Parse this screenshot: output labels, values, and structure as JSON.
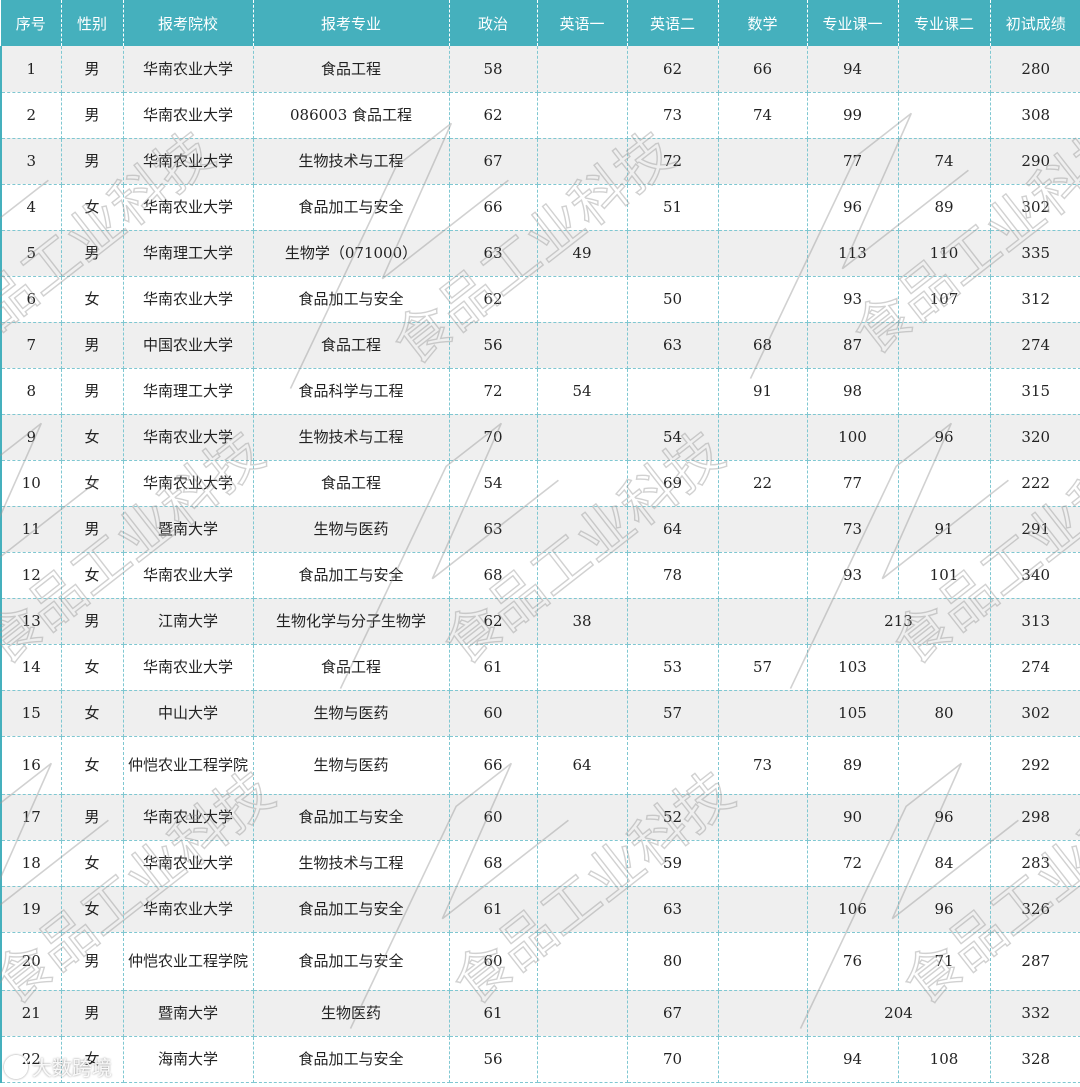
{
  "table": {
    "headers": [
      "序号",
      "性别",
      "报考院校",
      "报考专业",
      "政治",
      "英语一",
      "英语二",
      "数学",
      "专业课一",
      "专业课二",
      "初试成绩"
    ],
    "rows": [
      {
        "cells": [
          "1",
          "男",
          "华南农业大学",
          "食品工程",
          "58",
          "",
          "62",
          "66",
          "94",
          "",
          "280"
        ]
      },
      {
        "cells": [
          "2",
          "男",
          "华南农业大学",
          "086003 食品工程",
          "62",
          "",
          "73",
          "74",
          "99",
          "",
          "308"
        ]
      },
      {
        "cells": [
          "3",
          "男",
          "华南农业大学",
          "生物技术与工程",
          "67",
          "",
          "72",
          "",
          "77",
          "74",
          "290"
        ]
      },
      {
        "cells": [
          "4",
          "女",
          "华南农业大学",
          "食品加工与安全",
          "66",
          "",
          "51",
          "",
          "96",
          "89",
          "302"
        ]
      },
      {
        "cells": [
          "5",
          "男",
          "华南理工大学",
          "生物学（071000）",
          "63",
          "49",
          "",
          "",
          "113",
          "110",
          "335"
        ]
      },
      {
        "cells": [
          "6",
          "女",
          "华南农业大学",
          "食品加工与安全",
          "62",
          "",
          "50",
          "",
          "93",
          "107",
          "312"
        ]
      },
      {
        "cells": [
          "7",
          "男",
          "中国农业大学",
          "食品工程",
          "56",
          "",
          "63",
          "68",
          "87",
          "",
          "274"
        ]
      },
      {
        "cells": [
          "8",
          "男",
          "华南理工大学",
          "食品科学与工程",
          "72",
          "54",
          "",
          "91",
          "98",
          "",
          "315"
        ]
      },
      {
        "cells": [
          "9",
          "女",
          "华南农业大学",
          "生物技术与工程",
          "70",
          "",
          "54",
          "",
          "100",
          "96",
          "320"
        ]
      },
      {
        "cells": [
          "10",
          "女",
          "华南农业大学",
          "食品工程",
          "54",
          "",
          "69",
          "22",
          "77",
          "",
          "222"
        ]
      },
      {
        "cells": [
          "11",
          "男",
          "暨南大学",
          "生物与医药",
          "63",
          "",
          "64",
          "",
          "73",
          "91",
          "291"
        ]
      },
      {
        "cells": [
          "12",
          "女",
          "华南农业大学",
          "食品加工与安全",
          "68",
          "",
          "78",
          "",
          "93",
          "101",
          "340"
        ]
      },
      {
        "cells": [
          "13",
          "男",
          "江南大学",
          "生物化学与分子生物学",
          "62",
          "38",
          "",
          "",
          "213",
          "313"
        ],
        "merged": true
      },
      {
        "cells": [
          "14",
          "女",
          "华南农业大学",
          "食品工程",
          "61",
          "",
          "53",
          "57",
          "103",
          "",
          "274"
        ]
      },
      {
        "cells": [
          "15",
          "女",
          "中山大学",
          "生物与医药",
          "60",
          "",
          "57",
          "",
          "105",
          "80",
          "302"
        ]
      },
      {
        "cells": [
          "16",
          "女",
          "仲恺农业工程学院",
          "生物与医药",
          "66",
          "64",
          "",
          "73",
          "89",
          "",
          "292"
        ]
      },
      {
        "cells": [
          "17",
          "男",
          "华南农业大学",
          "食品加工与安全",
          "60",
          "",
          "52",
          "",
          "90",
          "96",
          "298"
        ]
      },
      {
        "cells": [
          "18",
          "女",
          "华南农业大学",
          "生物技术与工程",
          "68",
          "",
          "59",
          "",
          "72",
          "84",
          "283"
        ]
      },
      {
        "cells": [
          "19",
          "女",
          "华南农业大学",
          "食品加工与安全",
          "61",
          "",
          "63",
          "",
          "106",
          "96",
          "326"
        ]
      },
      {
        "cells": [
          "20",
          "男",
          "仲恺农业工程学院",
          "食品加工与安全",
          "60",
          "",
          "80",
          "",
          "76",
          "71",
          "287"
        ]
      },
      {
        "cells": [
          "21",
          "男",
          "暨南大学",
          "生物医药",
          "61",
          "",
          "67",
          "",
          "204",
          "332"
        ],
        "merged": true
      },
      {
        "cells": [
          "22",
          "女",
          "海南大学",
          "食品加工与安全",
          "56",
          "",
          "70",
          "",
          "94",
          "108",
          "328"
        ]
      }
    ]
  },
  "watermark": {
    "text": "食品工业科技",
    "color": "#9a9a9a"
  },
  "footer": {
    "text": "大数跨境"
  }
}
